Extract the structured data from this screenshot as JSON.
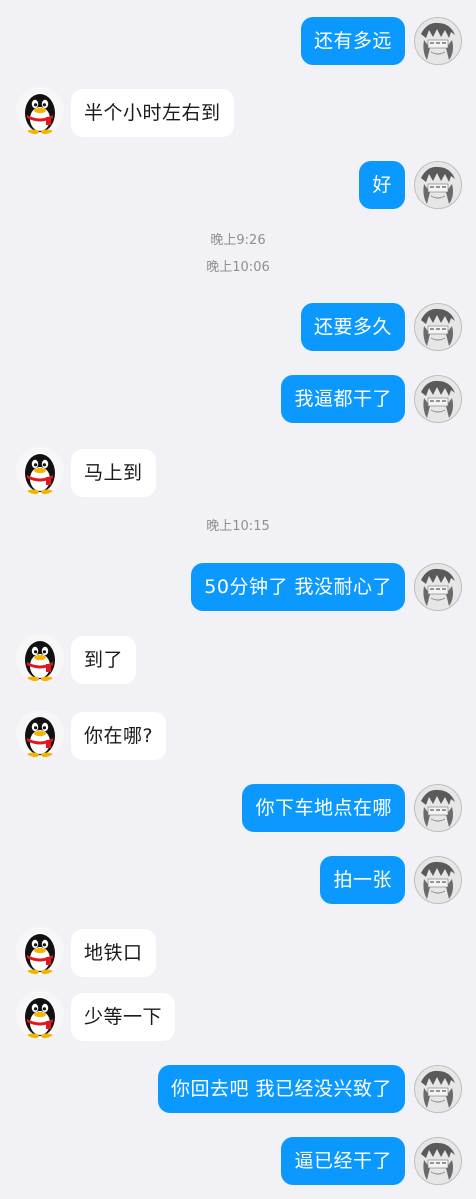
{
  "messages": [
    {
      "dir": "sent",
      "text": "还有多远"
    },
    {
      "dir": "recv",
      "text": "半个小时左右到"
    },
    {
      "dir": "sent",
      "text": "好"
    },
    {
      "dir": "sent",
      "text": "还要多久"
    },
    {
      "dir": "sent",
      "text": "我逼都干了"
    },
    {
      "dir": "recv",
      "text": "马上到"
    },
    {
      "dir": "sent",
      "text": "50分钟了  我没耐心了"
    },
    {
      "dir": "recv",
      "text": "到了"
    },
    {
      "dir": "recv",
      "text": "你在哪?"
    },
    {
      "dir": "sent",
      "text": "你下车地点在哪"
    },
    {
      "dir": "sent",
      "text": "拍一张"
    },
    {
      "dir": "recv",
      "text": "地铁口"
    },
    {
      "dir": "recv",
      "text": "少等一下"
    },
    {
      "dir": "sent",
      "text": "你回去吧 我已经没兴致了"
    },
    {
      "dir": "sent",
      "text": "逼已经干了"
    }
  ],
  "timestamps": [
    "晚上9:26",
    "晚上10:06",
    "晚上10:15"
  ],
  "avatars": {
    "self_icon": "anime-avatar-icon",
    "contact_icon": "qq-penguin-icon"
  },
  "colors": {
    "sent_bubble": "#0c99ff",
    "received_bubble": "#ffffff",
    "background": "#f2f2f6"
  }
}
